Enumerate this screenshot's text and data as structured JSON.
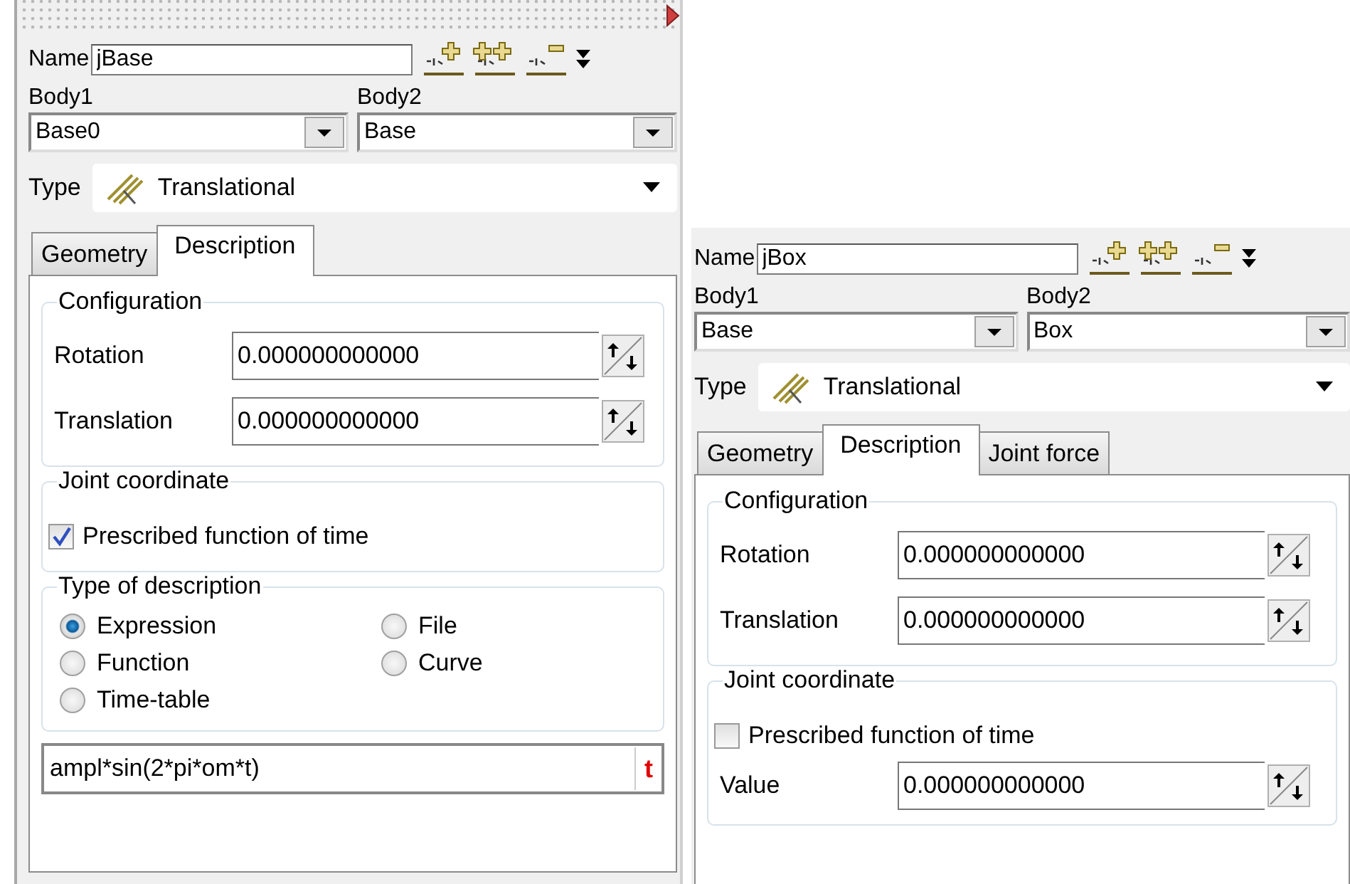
{
  "panels": [
    {
      "gripper": true,
      "name": {
        "label": "Name",
        "value": "jBase"
      },
      "body1": {
        "label": "Body1",
        "value": "Base0"
      },
      "body2": {
        "label": "Body2",
        "value": "Base"
      },
      "type": {
        "label": "Type",
        "value": "Translational"
      },
      "tabs": [
        {
          "label": "Geometry",
          "selected": false
        },
        {
          "label": "Description",
          "selected": true
        }
      ],
      "configuration": {
        "title": "Configuration",
        "fields": [
          {
            "label": "Rotation",
            "value": "0.000000000000"
          },
          {
            "label": "Translation",
            "value": "0.000000000000"
          }
        ]
      },
      "joint_coordinate": {
        "title": "Joint coordinate",
        "checkbox": {
          "label": "Prescribed function of time",
          "checked": true
        }
      },
      "description_type": {
        "title": "Type of description",
        "options": [
          {
            "label": "Expression",
            "selected": true
          },
          {
            "label": "Function",
            "selected": false
          },
          {
            "label": "Time-table",
            "selected": false
          },
          {
            "label": "File",
            "selected": false
          },
          {
            "label": "Curve",
            "selected": false
          }
        ]
      },
      "expression": {
        "value": "ampl*sin(2*pi*om*t)",
        "button": "t"
      }
    },
    {
      "gripper": false,
      "name": {
        "label": "Name",
        "value": "jBox"
      },
      "body1": {
        "label": "Body1",
        "value": "Base"
      },
      "body2": {
        "label": "Body2",
        "value": "Box"
      },
      "type": {
        "label": "Type",
        "value": "Translational"
      },
      "tabs": [
        {
          "label": "Geometry",
          "selected": false
        },
        {
          "label": "Description",
          "selected": true
        },
        {
          "label": "Joint force",
          "selected": false
        }
      ],
      "configuration": {
        "title": "Configuration",
        "fields": [
          {
            "label": "Rotation",
            "value": "0.000000000000"
          },
          {
            "label": "Translation",
            "value": "0.000000000000"
          }
        ]
      },
      "joint_coordinate": {
        "title": "Joint coordinate",
        "checkbox": {
          "label": "Prescribed function of time",
          "checked": false
        },
        "fields": [
          {
            "label": "Value",
            "value": "0.000000000000"
          }
        ]
      }
    }
  ]
}
